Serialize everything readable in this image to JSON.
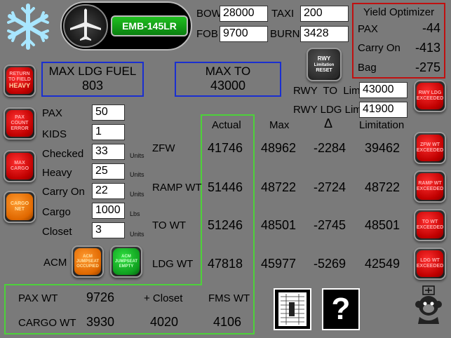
{
  "aircraft": {
    "model": "EMB-145LR"
  },
  "weights": {
    "bow_label": "BOW",
    "bow_value": "28000",
    "fob_label": "FOB",
    "fob_value": "9700",
    "taxi_label": "TAXI",
    "taxi_value": "200",
    "burn_label": "BURN",
    "burn_value": "3428"
  },
  "yield_optimizer": {
    "title": "Yield Optimizer",
    "rows": [
      {
        "label": "PAX",
        "value": "-44"
      },
      {
        "label": "Carry On",
        "value": "-413"
      },
      {
        "label": "Bag",
        "value": "-275"
      }
    ]
  },
  "buttons": {
    "return_to_field": "RETURN TO FIELD",
    "return_to_field_status": "HEAVY",
    "rwy_reset_line1": "RWY",
    "rwy_reset_line2": "Limitation",
    "rwy_reset_line3": "RESET",
    "pax_count_error": "PAX COUNT ERROR",
    "max_cargo": "MAX CARGO",
    "cargo_net": "CARGO NET",
    "acm_occupied": "ACM JUMPSEAT OCCUPIED",
    "acm_empty": "ACM JUMPSEAT EMPTY",
    "rwy_ldg_exceeded": "RWY LDG EXCEEDED",
    "zfw_exceeded": "ZFW WT EXCEEDED",
    "ramp_exceeded": "RAMP WT EXCEEDED",
    "to_exceeded": "TO WT EXCEEDED",
    "ldg_exceeded": "LDG WT EXCEEDED",
    "help": "?"
  },
  "max_ldg_fuel": {
    "label": "MAX LDG FUEL",
    "value": "803"
  },
  "max_to": {
    "label": "MAX TO",
    "value": "43000"
  },
  "runway": {
    "to_label": "RWY  TO  Lim",
    "to_value": "43000",
    "ldg_label": "RWY LDG Lim",
    "ldg_value": "41900"
  },
  "inputs": [
    {
      "label": "PAX",
      "value": "50",
      "unit": ""
    },
    {
      "label": "KIDS",
      "value": "1",
      "unit": ""
    },
    {
      "label": "Checked",
      "value": "33",
      "unit": "Units"
    },
    {
      "label": "Heavy",
      "value": "25",
      "unit": "Units"
    },
    {
      "label": "Carry On",
      "value": "22",
      "unit": "Units"
    },
    {
      "label": "Cargo",
      "value": "1000",
      "unit": "Lbs"
    },
    {
      "label": "Closet",
      "value": "3",
      "unit": "Units"
    }
  ],
  "acm_label": "ACM",
  "table": {
    "headers": {
      "actual": "Actual",
      "max": "Max",
      "delta": "Δ",
      "limitation": "Limitation"
    },
    "rows": [
      {
        "label": "ZFW",
        "actual": "41746",
        "max": "48962",
        "delta": "-2284",
        "limitation": "39462"
      },
      {
        "label": "RAMP WT",
        "actual": "51446",
        "max": "48722",
        "delta": "-2724",
        "limitation": "48722"
      },
      {
        "label": "TO WT",
        "actual": "51246",
        "max": "48501",
        "delta": "-2745",
        "limitation": "48501"
      },
      {
        "label": "LDG WT",
        "actual": "47818",
        "max": "45977",
        "delta": "-5269",
        "limitation": "42549"
      }
    ]
  },
  "summary": {
    "pax_wt_label": "PAX WT",
    "pax_wt_value": "9726",
    "closet_label": "+ Closet",
    "fms_label": "FMS WT",
    "cargo_wt_label": "CARGO WT",
    "cargo_wt_value": "3930",
    "closet_value": "4020",
    "fms_value": "4106"
  },
  "colors": {
    "background": "#7a7a7a",
    "blue_box": "#1a2fd0",
    "green_box": "#4dd13a",
    "red_box": "#c01010"
  }
}
